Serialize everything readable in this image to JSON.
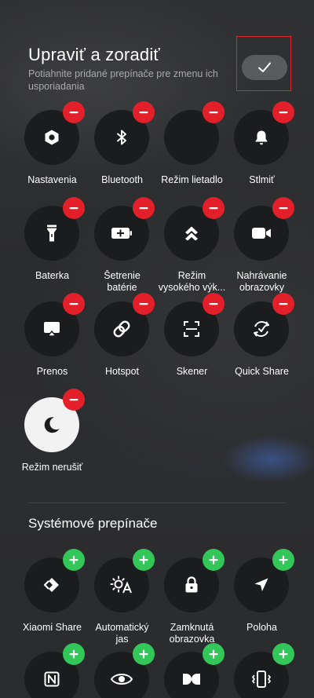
{
  "header": {
    "title": "Upraviť a zoradiť",
    "subtitle": "Potiahnite pridané prepínače pre zmenu ich usporiadania",
    "done_icon": "check-icon"
  },
  "active_tiles": [
    {
      "label_lines": [
        "Nastavenia"
      ],
      "icon": "hexagon-settings-icon"
    },
    {
      "label_lines": [
        "Bluetooth"
      ],
      "icon": "bluetooth-icon"
    },
    {
      "label_lines": [
        "Režim lietadlo"
      ],
      "icon": "airplane-icon"
    },
    {
      "label_lines": [
        "Stlmiť"
      ],
      "icon": "bell-icon"
    },
    {
      "label_lines": [
        "Baterka"
      ],
      "icon": "flashlight-icon"
    },
    {
      "label_lines": [
        "Šetrenie",
        "batérie"
      ],
      "icon": "battery-saver-icon"
    },
    {
      "label_lines": [
        "Režim",
        "vysokého výk..."
      ],
      "icon": "double-chevron-up-icon"
    },
    {
      "label_lines": [
        "Nahrávanie",
        "obrazovky"
      ],
      "icon": "video-camera-icon"
    },
    {
      "label_lines": [
        "Prenos"
      ],
      "icon": "cast-icon"
    },
    {
      "label_lines": [
        "Hotspot"
      ],
      "icon": "link-icon"
    },
    {
      "label_lines": [
        "Skener"
      ],
      "icon": "scanner-icon"
    },
    {
      "label_lines": [
        "Quick Share"
      ],
      "icon": "quick-share-icon"
    },
    {
      "label_lines": [
        "Režim nerušiť"
      ],
      "icon": "moon-icon"
    }
  ],
  "system_section": {
    "title": "Systémové prepínače"
  },
  "system_tiles": [
    {
      "label_lines": [
        "Xiaomi Share"
      ],
      "icon": "xiaomi-share-icon"
    },
    {
      "label_lines": [
        "Automatický",
        "jas"
      ],
      "icon": "auto-brightness-icon"
    },
    {
      "label_lines": [
        "Zamknutá",
        "obrazovka"
      ],
      "icon": "lock-icon"
    },
    {
      "label_lines": [
        "Poloha"
      ],
      "icon": "location-arrow-icon"
    },
    {
      "label_lines": [],
      "icon": "nfc-icon"
    },
    {
      "label_lines": [],
      "icon": "eye-icon"
    },
    {
      "label_lines": [],
      "icon": "dolby-icon"
    },
    {
      "label_lines": [],
      "icon": "vibrate-icon"
    }
  ],
  "colors": {
    "remove_badge": "#e3202a",
    "add_badge": "#33c759",
    "tile_bg": "#1b1c1e",
    "highlight_box": "#e0242b"
  }
}
